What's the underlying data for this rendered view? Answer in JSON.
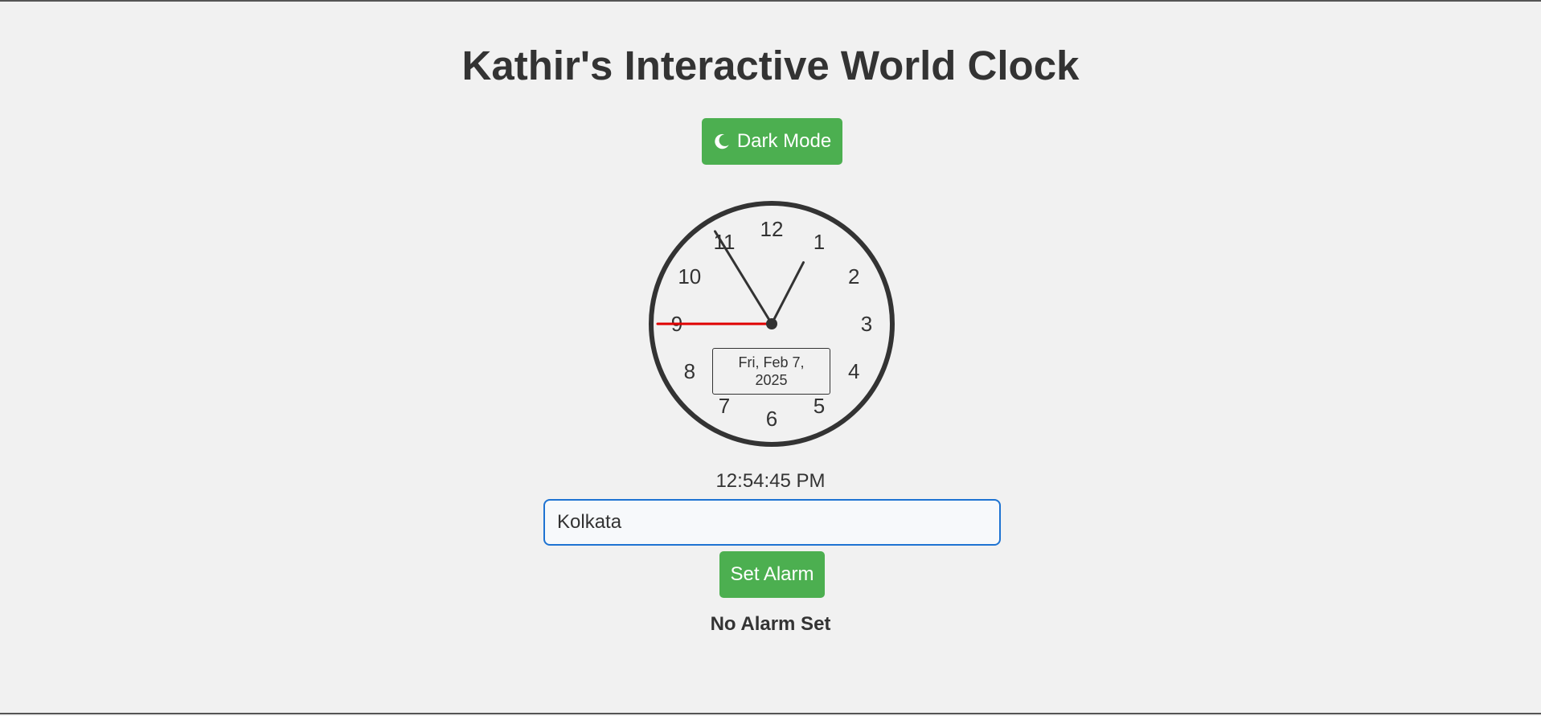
{
  "app": {
    "title": "Kathir's Interactive World Clock"
  },
  "theme_toggle": {
    "label": "Dark Mode",
    "icon": "moon-icon"
  },
  "clock": {
    "numbers": [
      "12",
      "1",
      "2",
      "3",
      "4",
      "5",
      "6",
      "7",
      "8",
      "9",
      "10",
      "11"
    ],
    "date_label": "Fri, Feb 7, 2025",
    "hour": 12,
    "minute": 54,
    "second": 45,
    "colors": {
      "face_border": "#333333",
      "hands": "#333333",
      "second_hand": "#e00000"
    }
  },
  "digital_time": "12:54:45 PM",
  "timezone_input": {
    "value": "Kolkata"
  },
  "alarm": {
    "button_label": "Set Alarm",
    "status": "No Alarm Set"
  },
  "colors": {
    "accent": "#4caf50",
    "background": "#f1f1f1",
    "input_focus": "#1e73d2"
  }
}
